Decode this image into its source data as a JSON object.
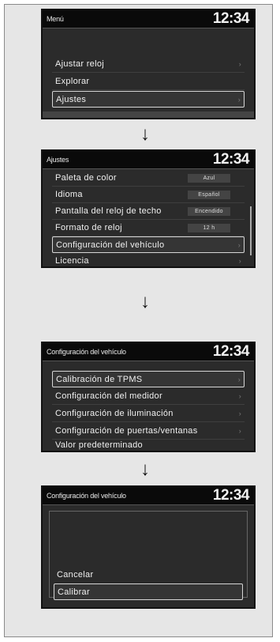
{
  "clock": "12:34",
  "screen1": {
    "title": "Menú",
    "items": [
      "Ajustar reloj",
      "Explorar",
      "Ajustes"
    ]
  },
  "screen2": {
    "title": "Ajustes",
    "items": [
      {
        "label": "Paleta de color",
        "value": "Azul"
      },
      {
        "label": "Idioma",
        "value": "Español"
      },
      {
        "label": "Pantalla del reloj de techo",
        "value": "Encendido"
      },
      {
        "label": "Formato de reloj",
        "value": "12 h"
      },
      {
        "label": "Configuración del vehículo",
        "value": ""
      },
      {
        "label": "Licencia",
        "value": ""
      }
    ]
  },
  "screen3": {
    "title": "Configuración del vehículo",
    "items": [
      "Calibración de TPMS",
      "Configuración del medidor",
      "Configuración de iluminación",
      "Configuración de puertas/ventanas",
      "Valor predeterminado"
    ]
  },
  "screen4": {
    "title": "Configuración del vehículo",
    "items": [
      "Cancelar",
      "Calibrar"
    ]
  },
  "arrow_glyph": "↓"
}
